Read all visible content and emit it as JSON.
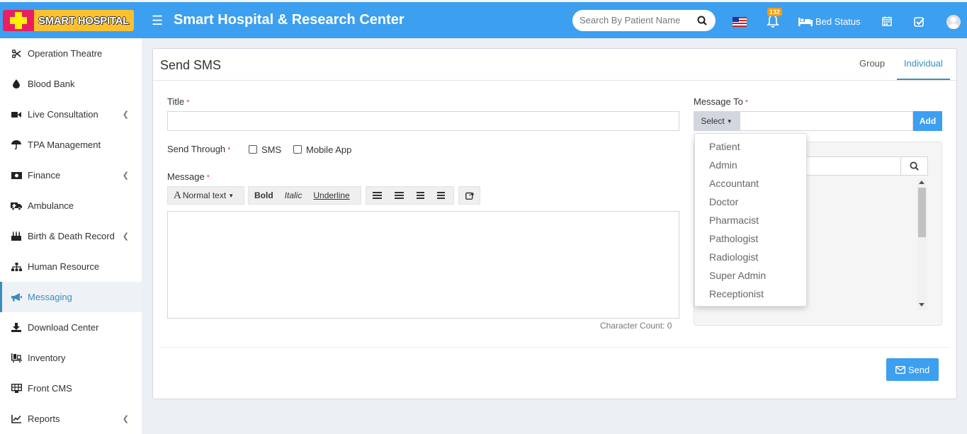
{
  "header": {
    "logo_text": "SMART HOSPITAL",
    "title": "Smart Hospital & Research Center",
    "search_placeholder": "Search By Patient Name",
    "notification_count": "132",
    "bed_status_label": "Bed Status"
  },
  "sidebar": {
    "items": [
      {
        "label": "Operation Theatre",
        "icon": "scissors-icon",
        "has_children": false
      },
      {
        "label": "Blood Bank",
        "icon": "tint-icon",
        "has_children": false
      },
      {
        "label": "Live Consultation",
        "icon": "video-icon",
        "has_children": true
      },
      {
        "label": "TPA Management",
        "icon": "umbrella-icon",
        "has_children": false
      },
      {
        "label": "Finance",
        "icon": "money-icon",
        "has_children": true
      },
      {
        "label": "Ambulance",
        "icon": "ambulance-icon",
        "has_children": false
      },
      {
        "label": "Birth & Death Record",
        "icon": "birthday-cake-icon",
        "has_children": true
      },
      {
        "label": "Human Resource",
        "icon": "sitemap-icon",
        "has_children": false
      },
      {
        "label": "Messaging",
        "icon": "bullhorn-icon",
        "has_children": false,
        "active": true
      },
      {
        "label": "Download Center",
        "icon": "download-icon",
        "has_children": false
      },
      {
        "label": "Inventory",
        "icon": "inventory-icon",
        "has_children": false
      },
      {
        "label": "Front CMS",
        "icon": "cms-icon",
        "has_children": false
      },
      {
        "label": "Reports",
        "icon": "line-chart-icon",
        "has_children": true
      }
    ]
  },
  "main": {
    "title": "Send SMS",
    "tabs": [
      {
        "label": "Group",
        "active": false
      },
      {
        "label": "Individual",
        "active": true
      }
    ],
    "form": {
      "title_label": "Title",
      "title_value": "",
      "send_through_label": "Send Through",
      "sms_label": "SMS",
      "mobile_app_label": "Mobile App",
      "message_label": "Message",
      "message_value": "",
      "editor": {
        "normal_text": "Normal text",
        "bold": "Bold",
        "italic": "Italic",
        "underline": "Underline"
      },
      "character_count": "Character Count: 0",
      "send_label": "Send"
    },
    "message_to": {
      "label": "Message To",
      "select_label": "Select",
      "add_label": "Add",
      "options": [
        "Patient",
        "Admin",
        "Accountant",
        "Doctor",
        "Pharmacist",
        "Pathologist",
        "Radiologist",
        "Super Admin",
        "Receptionist"
      ]
    }
  },
  "colors": {
    "header_bg": "#3c9ff0",
    "accent": "#3c8dbc",
    "required": "#dd4b39",
    "badge": "#f39c12"
  }
}
